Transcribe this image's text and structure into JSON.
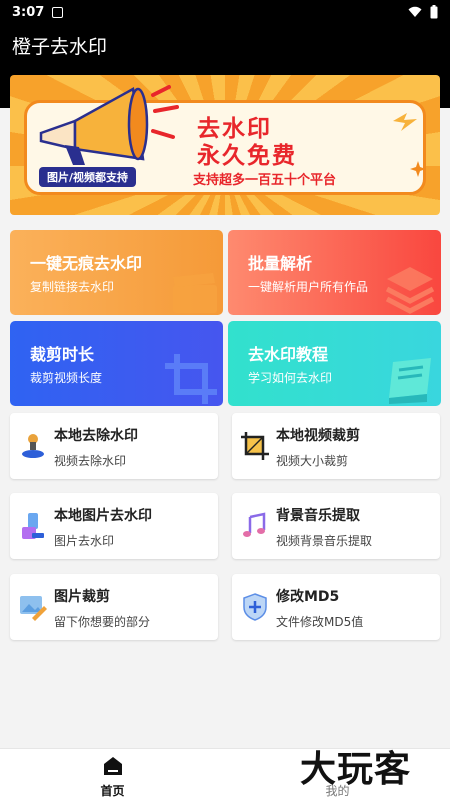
{
  "status": {
    "time": "3:07"
  },
  "app": {
    "title": "橙子去水印"
  },
  "banner": {
    "title_line1": "去水印",
    "title_line2": "永久免费",
    "pill": "图片/视频都支持",
    "subtitle": "支持超多一百五十个平台"
  },
  "features": [
    {
      "title": "一键无痕去水印",
      "subtitle": "复制链接去水印",
      "icon": "clapperboard-icon",
      "color": "#f59a38"
    },
    {
      "title": "批量解析",
      "subtitle": "一键解析用户所有作品",
      "icon": "layers-icon",
      "color": "#f9473f"
    },
    {
      "title": "裁剪时长",
      "subtitle": "裁剪视频长度",
      "icon": "crop-icon",
      "color": "#3b5cf0"
    },
    {
      "title": "去水印教程",
      "subtitle": "学习如何去水印",
      "icon": "book-icon",
      "color": "#34dad5"
    }
  ],
  "tools": [
    {
      "title": "本地去除水印",
      "subtitle": "视频去除水印",
      "icon": "stamp-icon"
    },
    {
      "title": "本地视频裁剪",
      "subtitle": "视频大小裁剪",
      "icon": "crop-icon"
    },
    {
      "title": "本地图片去水印",
      "subtitle": "图片去水印",
      "icon": "paint-roller-icon"
    },
    {
      "title": "背景音乐提取",
      "subtitle": "视频背景音乐提取",
      "icon": "music-note-icon"
    },
    {
      "title": "图片裁剪",
      "subtitle": "留下你想要的部分",
      "icon": "image-edit-icon"
    },
    {
      "title": "修改MD5",
      "subtitle": "文件修改MD5值",
      "icon": "shield-plus-icon"
    }
  ],
  "nav": {
    "home": "首页",
    "me": "我的"
  },
  "watermark": "大玩客"
}
